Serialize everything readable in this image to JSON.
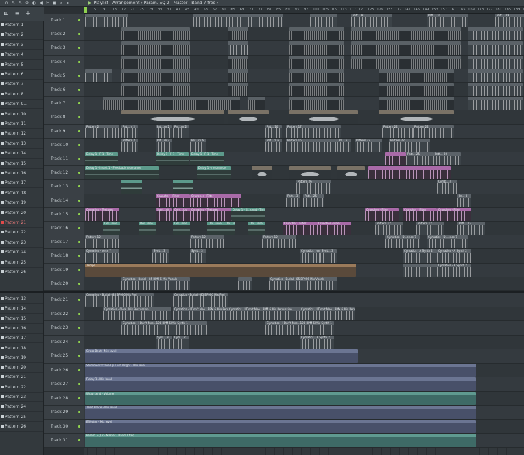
{
  "window": {
    "title": "Playlist - Arrangement › Param. EQ 2 - Master - Band 7 freq ›"
  },
  "toolbar": {
    "tools": [
      {
        "icon": "magnet-icon",
        "glyph": "∩"
      },
      {
        "icon": "pencil-icon",
        "glyph": "✎"
      },
      {
        "icon": "paint-icon",
        "glyph": "✎"
      },
      {
        "icon": "delete-icon",
        "glyph": "⊘"
      },
      {
        "icon": "mute-icon",
        "glyph": "◐"
      },
      {
        "icon": "slip-icon",
        "glyph": "◀"
      },
      {
        "icon": "slice-icon",
        "glyph": "✂"
      },
      {
        "icon": "select-icon",
        "glyph": "▣"
      },
      {
        "icon": "zoom-icon",
        "glyph": "⌕"
      },
      {
        "icon": "playback-icon",
        "glyph": "▸"
      }
    ]
  },
  "picker": {
    "header_icons": [
      "waveform-icon",
      "sort-icon",
      "grid-icon"
    ],
    "patterns_top": [
      "Pattern 1",
      "Pattern 2",
      "Pattern 3",
      "Pattern 4",
      "Pattern 5",
      "Pattern 6",
      "Pattern 7",
      "Pattern 8...",
      "Pattern 9...",
      "Pattern 10",
      "Pattern 11",
      "Pattern 12",
      "Pattern 13",
      "Pattern 14",
      "Pattern 15",
      "Pattern 16",
      "Pattern 17",
      "Pattern 18",
      "Pattern 19",
      "Pattern 20",
      "Pattern 21",
      "Pattern 22",
      "Pattern 23",
      "Pattern 24",
      "Pattern 25",
      "Pattern 26"
    ],
    "patterns_bottom": [
      "Pattern 13",
      "Pattern 14",
      "Pattern 15",
      "Pattern 16",
      "Pattern 17",
      "Pattern 18",
      "Pattern 19",
      "Pattern 20",
      "Pattern 21",
      "Pattern 22",
      "Pattern 23",
      "Pattern 24",
      "Pattern 25",
      "Pattern 26"
    ],
    "active_pattern": "Pattern 21"
  },
  "ruler": {
    "ticks": [
      "5",
      "9",
      "13",
      "17",
      "21",
      "25",
      "29",
      "33",
      "37",
      "41",
      "45",
      "49",
      "53",
      "57",
      "61",
      "65",
      "69",
      "73",
      "77",
      "81",
      "85",
      "89",
      "93",
      "97",
      "101",
      "105",
      "109",
      "113",
      "117",
      "121",
      "125",
      "129",
      "133",
      "137",
      "141",
      "145",
      "149",
      "153",
      "157",
      "161",
      "165",
      "169",
      "173",
      "177",
      "181",
      "185",
      "189",
      "193"
    ]
  },
  "tracks_top": [
    {
      "name": "Track 1",
      "clips": [
        [
          "k-pat",
          "",
          2,
          62
        ],
        [
          "k-pat",
          "",
          160,
          130
        ],
        [
          "k-pat",
          "",
          330,
          40
        ],
        [
          "k-pat",
          "Patt... 8",
          390,
          60
        ],
        [
          "k-pat",
          "Patt... 10",
          500,
          60
        ],
        [
          "k-pat",
          "Patt... 29",
          600,
          60
        ]
      ]
    },
    {
      "name": "Track 2",
      "clips": [
        [
          "k-pat2",
          "",
          55,
          100
        ],
        [
          "k-pat2",
          "",
          210,
          30
        ],
        [
          "k-pat2",
          "",
          300,
          80
        ],
        [
          "k-pat2",
          "",
          390,
          160
        ],
        [
          "k-pat",
          "",
          560,
          80
        ]
      ]
    },
    {
      "name": "Track 3",
      "clips": [
        [
          "k-pat2",
          "",
          55,
          100
        ],
        [
          "k-pat",
          "",
          210,
          30
        ],
        [
          "k-pat2",
          "",
          300,
          80
        ],
        [
          "k-pat2",
          "",
          390,
          160
        ],
        [
          "k-pat",
          "",
          560,
          80
        ]
      ]
    },
    {
      "name": "Track 4",
      "clips": [
        [
          "k-pat2",
          "",
          55,
          100
        ],
        [
          "k-pat2",
          "",
          210,
          30
        ],
        [
          "k-pat2",
          "",
          300,
          80
        ],
        [
          "k-pat2",
          "",
          390,
          160
        ],
        [
          "k-pat",
          "",
          560,
          80
        ]
      ]
    },
    {
      "name": "Track 5",
      "clips": [
        [
          "k-pat",
          "",
          2,
          40
        ],
        [
          "k-pat2",
          "",
          55,
          100
        ],
        [
          "k-pat2",
          "",
          210,
          30
        ],
        [
          "k-pat2",
          "",
          300,
          80
        ],
        [
          "k-pat2",
          "",
          430,
          110
        ],
        [
          "k-pat",
          "",
          560,
          80
        ]
      ]
    },
    {
      "name": "Track 6",
      "clips": [
        [
          "k-pat2",
          "",
          55,
          100
        ],
        [
          "k-pat2",
          "",
          210,
          30
        ],
        [
          "k-pat2",
          "",
          300,
          80
        ],
        [
          "k-pat2",
          "",
          430,
          110
        ],
        [
          "k-pat",
          "",
          560,
          80
        ]
      ]
    },
    {
      "name": "Track 7",
      "clips": [
        [
          "k-pat2",
          "",
          28,
          200
        ],
        [
          "k-pat2",
          "",
          240,
          24
        ],
        [
          "k-pat2",
          "",
          300,
          80
        ],
        [
          "k-pat2",
          "",
          430,
          110
        ],
        [
          "k-pat",
          "",
          560,
          80
        ]
      ]
    },
    {
      "name": "Track 8",
      "clips": [
        [
          "k-aud",
          "",
          55,
          150
        ],
        [
          "k-aud",
          "",
          210,
          60
        ],
        [
          "k-aud",
          "",
          300,
          100
        ],
        [
          "k-aud",
          "",
          430,
          110
        ]
      ]
    },
    {
      "name": "Track 9",
      "clips": [
        [
          "k-pat",
          "Pattern 2",
          2,
          50
        ],
        [
          "k-pat",
          "Pat...rn 2",
          55,
          24
        ],
        [
          "k-pat",
          "Pat...rn 2",
          105,
          24
        ],
        [
          "k-pat",
          "Pat...rn 2",
          130,
          24
        ],
        [
          "k-pat",
          "Pat... 10",
          265,
          24
        ],
        [
          "k-pat",
          "Pattern 17",
          295,
          80
        ],
        [
          "k-pat",
          "Pattern 22",
          435,
          80
        ],
        [
          "k-pat",
          "Pattern 22",
          480,
          60
        ]
      ]
    },
    {
      "name": "Track 10",
      "clips": [
        [
          "k-pat",
          "Pattern 2",
          55,
          24
        ],
        [
          "k-pat",
          "Pat...rn 2",
          105,
          24
        ],
        [
          "k-pat",
          "Pat...rn 6",
          155,
          24
        ],
        [
          "k-pat",
          "Pat...rn 6",
          265,
          24
        ],
        [
          "k-pat",
          "Pattern 15",
          295,
          80
        ],
        [
          "k-pat",
          "Pa... 5",
          370,
          20
        ],
        [
          "k-pat",
          "Pattern 22",
          395,
          40
        ],
        [
          "k-pat",
          "Pattern 22",
          445,
          60
        ]
      ]
    },
    {
      "name": "Track 11",
      "clips": [
        [
          "k-teal",
          "Delay 1 - F 1 - Time",
          2,
          48
        ],
        [
          "k-teal",
          "Delay 1 - F 1 - Time",
          105,
          48
        ],
        [
          "k-teal",
          "Delay 1 - F 1 - Time",
          155,
          50
        ],
        [
          "k-pink",
          "",
          440,
          30
        ],
        [
          "k-pat",
          "Patt... 25",
          470,
          40
        ],
        [
          "k-pat",
          "Patt... 30",
          510,
          40
        ]
      ]
    },
    {
      "name": "Track 12",
      "clips": [
        [
          "k-teal",
          "Delay 1 - Insert 1 - Feedback resonance",
          2,
          108
        ],
        [
          "k-teal",
          "Delay 1 - resonance",
          165,
          50
        ],
        [
          "k-aud",
          "",
          245,
          30
        ],
        [
          "k-aud",
          "",
          300,
          60
        ],
        [
          "k-aud",
          "",
          370,
          40
        ],
        [
          "k-pink",
          "",
          415,
          120
        ]
      ]
    },
    {
      "name": "Track 13",
      "clips": [
        [
          "k-teal",
          "",
          55,
          30
        ],
        [
          "k-teal",
          "",
          130,
          30
        ],
        [
          "k-pat",
          "Pattern 26",
          310,
          50
        ],
        [
          "k-pat",
          "Cymb... 4",
          515,
          30
        ]
      ]
    },
    {
      "name": "Track 14",
      "clips": [
        [
          "k-pink",
          "Cruncher - Filter",
          105,
          50
        ],
        [
          "k-pink",
          "Cruncher - Filter",
          155,
          75
        ],
        [
          "k-pat",
          "Patt... 3",
          295,
          20
        ],
        [
          "k-pat",
          "Patt... 25",
          320,
          30
        ],
        [
          "k-pat",
          "Pa... 3",
          545,
          20
        ]
      ]
    },
    {
      "name": "Track 15",
      "clips": [
        [
          "k-pink",
          "Cymatics - Textures",
          2,
          50
        ],
        [
          "k-pink",
          "Synt...nic",
          105,
          24
        ],
        [
          "k-pink",
          "Cym...ics",
          130,
          30
        ],
        [
          "k-pink",
          "Cymatics - Textures",
          155,
          75
        ],
        [
          "k-teal",
          "Delay 1 - 4...send - Time",
          215,
          50
        ],
        [
          "k-pink",
          "Cruncher - Filter",
          410,
          50
        ],
        [
          "k-pink",
          "Cruncher - Filter",
          465,
          50
        ],
        [
          "k-pink",
          "Cruncher - Filter",
          515,
          50
        ]
      ]
    },
    {
      "name": "Track 16",
      "clips": [
        [
          "k-teal",
          "Del...inse",
          28,
          25
        ],
        [
          "k-teal",
          "Del...inse",
          80,
          25
        ],
        [
          "k-teal",
          "Del...inse",
          130,
          25
        ],
        [
          "k-teal",
          "Del...inse",
          180,
          25
        ],
        [
          "k-teal",
          "Del...ins",
          205,
          15
        ],
        [
          "k-teal",
          "Del...inse",
          240,
          25
        ],
        [
          "k-pink",
          "Cruncher - Filter",
          290,
          50
        ],
        [
          "k-pink",
          "Cruncher - Filter",
          340,
          50
        ],
        [
          "k-pat",
          "Pattern 12",
          425,
          40
        ],
        [
          "k-pat",
          "Pattern 12",
          485,
          40
        ],
        [
          "k-pat",
          "Patt... 12",
          545,
          40
        ]
      ]
    },
    {
      "name": "Track 17",
      "clips": [
        [
          "k-pat",
          "Pattern 12",
          2,
          50
        ],
        [
          "k-pat",
          "Pattern 12",
          155,
          50
        ],
        [
          "k-pat",
          "Pattern 12",
          260,
          50
        ],
        [
          "k-pat",
          "Cymatics - D...ence 7",
          440,
          50
        ],
        [
          "k-pat",
          "Cymatics - D...ence 7",
          500,
          60
        ]
      ]
    },
    {
      "name": "Track 18",
      "clips": [
        [
          "k-pat",
          "Cymatics - ence 7",
          2,
          50
        ],
        [
          "k-pat",
          "Synt... 3",
          100,
          24
        ],
        [
          "k-pat",
          "Synt... 3",
          155,
          24
        ],
        [
          "k-pat",
          "Cymatics - ence 7",
          315,
          45
        ],
        [
          "k-pat",
          "Synt... 3",
          345,
          24
        ],
        [
          "k-pat",
          "Cymatics - A Synth 2",
          465,
          50
        ],
        [
          "k-pat",
          "Cymatics - A Synth 2",
          515,
          50
        ]
      ]
    },
    {
      "name": "Track 19",
      "clips": [
        [
          "k-orange",
          "Tempo",
          2,
          395
        ],
        [
          "k-pat",
          "",
          465,
          50
        ],
        [
          "k-pat",
          "Cymatics - A Synth 2",
          515,
          50
        ]
      ]
    },
    {
      "name": "Track 20",
      "clips": [
        [
          "k-pat",
          "Cymatics - Burial - 85 BPM 6 Mix Vocals",
          55,
          100
        ],
        [
          "k-pat",
          "",
          225,
          20
        ],
        [
          "k-pat",
          "Cymatics - Burial - 85 BPM 6 Mix Vocals",
          270,
          100
        ]
      ]
    }
  ],
  "tracks_bottom": [
    {
      "name": "Track 21",
      "clips": [
        [
          "k-pat",
          "Cymatics - Burial - 85 BPM 6 Mix Pad",
          2,
          100
        ],
        [
          "k-pat",
          "Cymatics - Burial - 85 BPM 6 Mix Pad",
          130,
          80
        ]
      ]
    },
    {
      "name": "Track 22",
      "clips": [
        [
          "k-pat",
          "Cymatics - Clea...Mix Percussion",
          28,
          100
        ],
        [
          "k-pat",
          "Cymatics - I Don't Nee...BPM 6 Mix Percussion",
          130,
          100
        ],
        [
          "k-pat",
          "Cymatics - I Don't Nee...BPM 6 Mix Percussion",
          210,
          150
        ],
        [
          "k-pat",
          "Cymatics - I Don't Nee...BPM 6 Mix Percussion",
          315,
          80
        ]
      ]
    },
    {
      "name": "Track 23",
      "clips": [
        [
          "k-pat",
          "Cymatics - I Don't Nee...108 BPM 6 Mix Synth 1",
          55,
          125
        ],
        [
          "k-pat",
          "Cymatics - I Don't Nee...108 BPM 6 Mix Synth 1",
          265,
          100
        ]
      ]
    },
    {
      "name": "Track 24",
      "clips": [
        [
          "k-pat",
          "Synt... 3",
          105,
          24
        ],
        [
          "k-pat",
          "Cym... 2",
          130,
          24
        ],
        [
          "k-pat",
          "Cymatics - A Synth 2",
          315,
          50
        ]
      ]
    },
    {
      "name": "Track 25",
      "clips": [
        [
          "k-auto",
          "Gross Beat - Mix level",
          2,
          398
        ]
      ]
    },
    {
      "name": "Track 26",
      "clips": [
        [
          "k-auto",
          "Shimmer Octave Up Lush Bright - Mix level",
          2,
          570
        ]
      ]
    },
    {
      "name": "Track 27",
      "clips": [
        [
          "k-auto",
          "Delay 3 - Mix level",
          2,
          570
        ]
      ]
    },
    {
      "name": "Track 28",
      "clips": [
        [
          "k-autot",
          "Wrap send - Volume",
          2,
          570
        ]
      ]
    },
    {
      "name": "Track 29",
      "clips": [
        [
          "k-auto",
          "Tiled Brace - Mix level",
          2,
          570
        ]
      ]
    },
    {
      "name": "Track 30",
      "clips": [
        [
          "k-auto",
          "Effector - Mix level",
          2,
          570
        ]
      ]
    },
    {
      "name": "Track 31",
      "clips": [
        [
          "k-autot",
          "Param. EQ 2 - Master - Band 7 freq",
          2,
          570
        ]
      ]
    }
  ]
}
